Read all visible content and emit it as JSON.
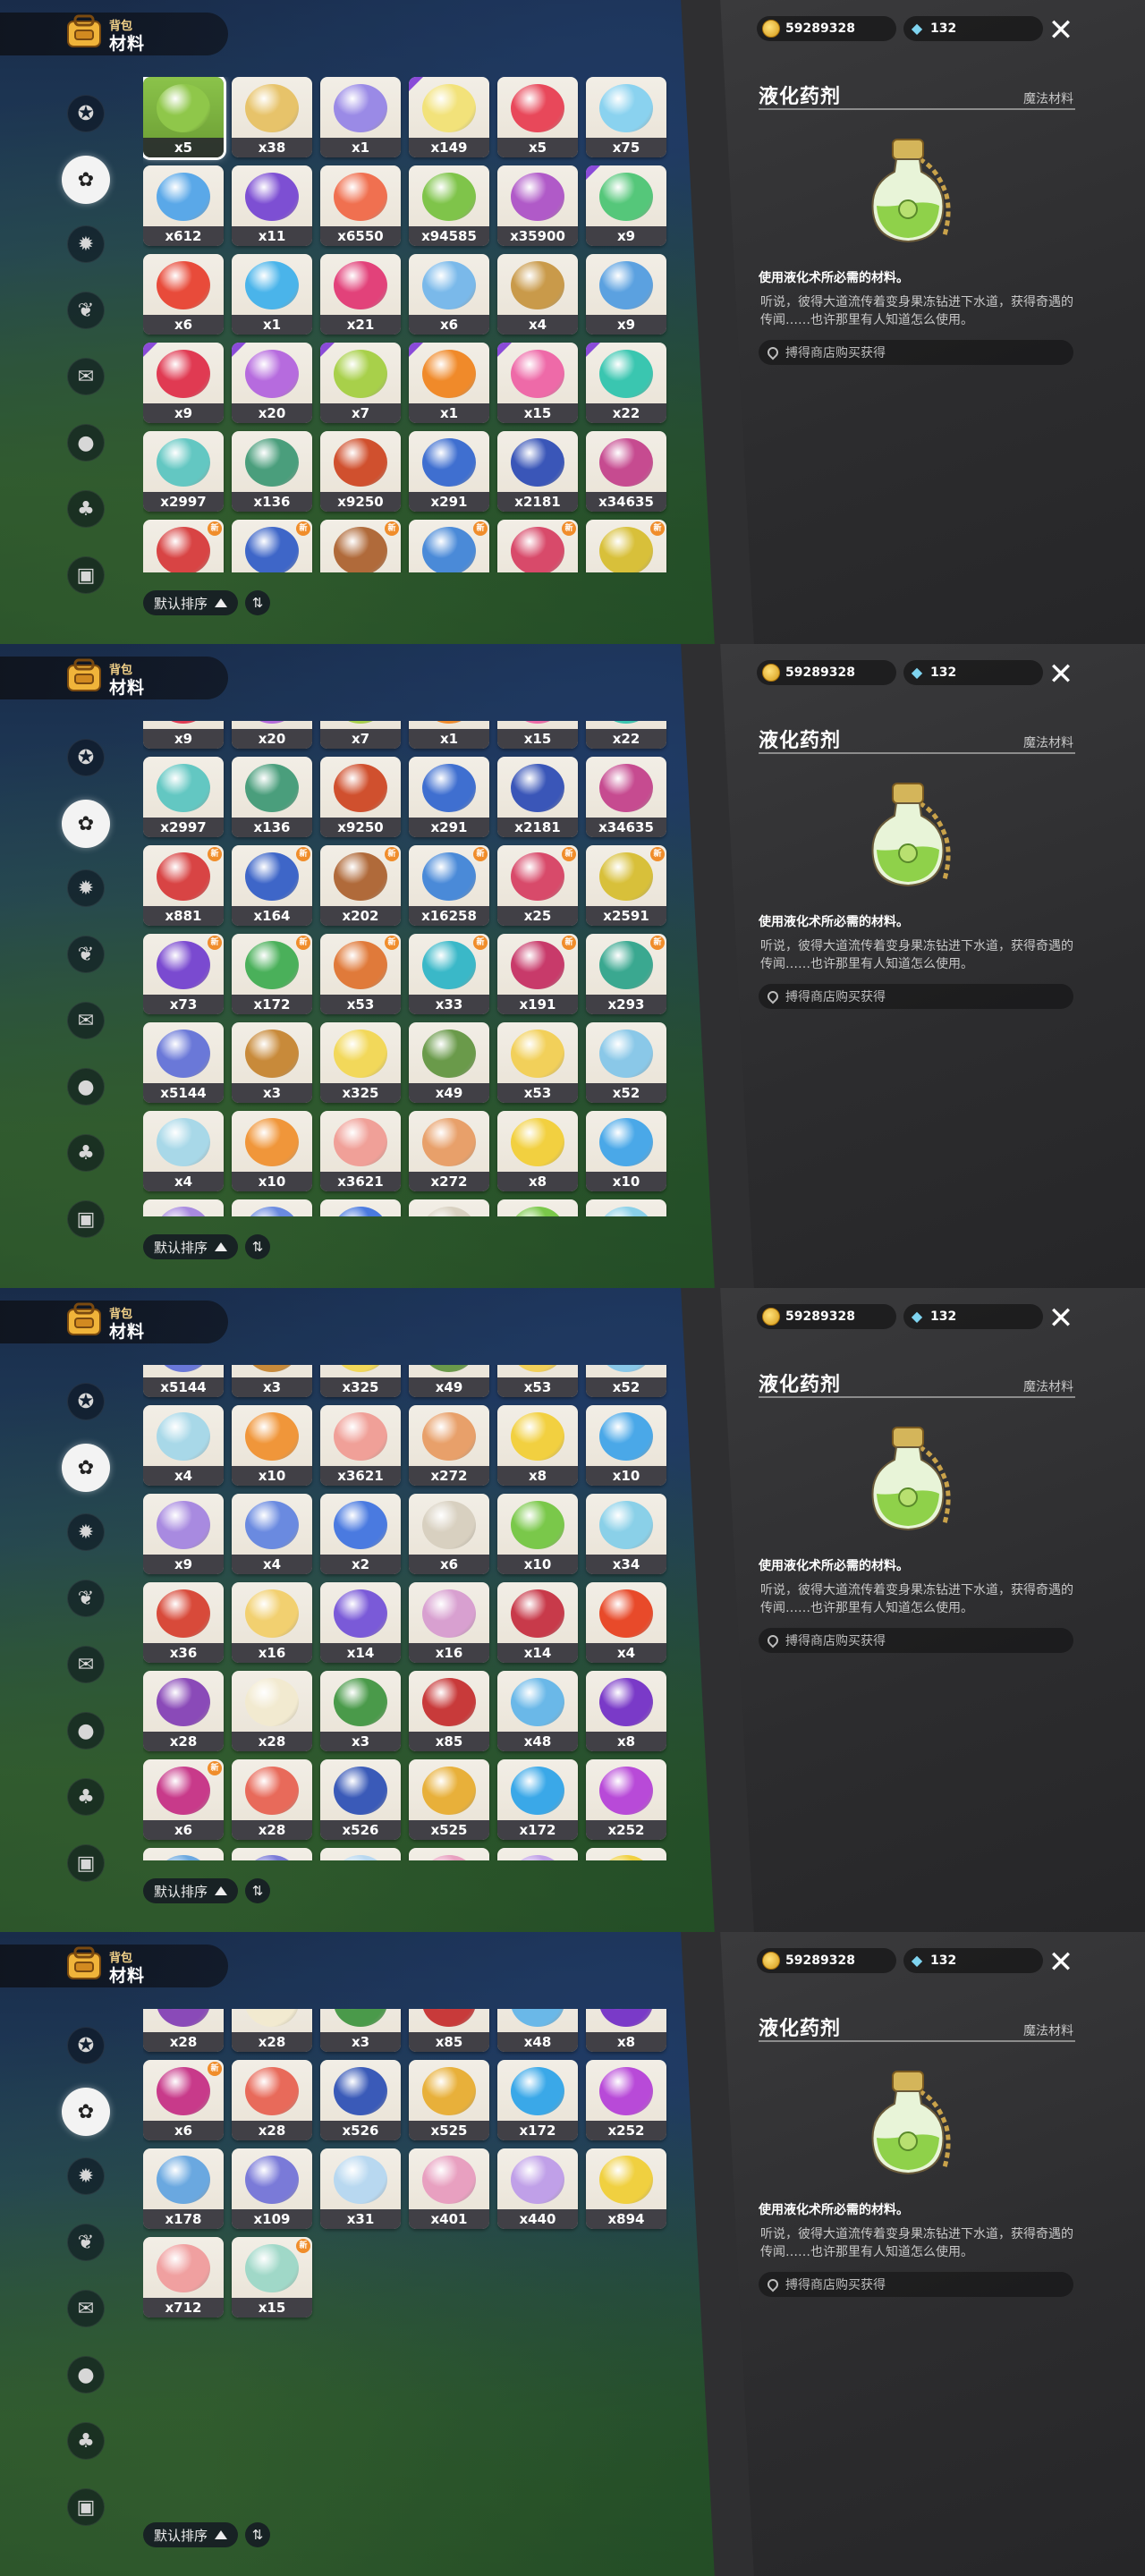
{
  "header": {
    "subtitle": "背包",
    "title": "材料"
  },
  "currency": {
    "coins": "59289328",
    "gems": "132"
  },
  "close_label": "✕",
  "sidebar": {
    "items": [
      {
        "icon": "star-badge-icon",
        "glyph": "✪"
      },
      {
        "icon": "leaf-cluster-icon",
        "glyph": "✿"
      },
      {
        "icon": "gear-star-icon",
        "glyph": "✹"
      },
      {
        "icon": "sprout-icon",
        "glyph": "❦"
      },
      {
        "icon": "scroll-icon",
        "glyph": "✉"
      },
      {
        "icon": "ball-icon",
        "glyph": "●"
      },
      {
        "icon": "acorn-icon",
        "glyph": "♣"
      },
      {
        "icon": "chest-icon",
        "glyph": "▣"
      }
    ],
    "active_index": 1
  },
  "sort": {
    "label": "默认排序",
    "toggle": "⇅"
  },
  "detail": {
    "name": "液化药剂",
    "category": "魔法材料",
    "description": "使用液化术所必需的材料。",
    "flavor": "听说，彼得大道流传着变身果冻钻进下水道，获得奇遇的传闻……也许那里有人知道怎么使用。",
    "source": "搏得商店购买获得"
  },
  "colors": {
    "selected": "#8bc34a",
    "rare_corner": "#8a4bd8",
    "new_badge": "#f08d2b"
  },
  "items": [
    {
      "q": "x5",
      "c": "#8fc74a",
      "sel": true,
      "r": false
    },
    {
      "q": "x38",
      "c": "#e7c36a",
      "r": false
    },
    {
      "q": "x1",
      "c": "#9a8ae6",
      "r": false
    },
    {
      "q": "x149",
      "c": "#f2e27a",
      "r": true
    },
    {
      "q": "x5",
      "c": "#e8485a",
      "r": false
    },
    {
      "q": "x75",
      "c": "#8ad2ef",
      "r": false
    },
    {
      "q": "x612",
      "c": "#5aa8e8",
      "r": false
    },
    {
      "q": "x11",
      "c": "#7d4fd3",
      "r": false
    },
    {
      "q": "x6550",
      "c": "#f07050",
      "r": false
    },
    {
      "q": "x94585",
      "c": "#7fc44a",
      "r": false
    },
    {
      "q": "x35900",
      "c": "#b05ac8",
      "r": false
    },
    {
      "q": "x9",
      "c": "#55c77a",
      "r": true
    },
    {
      "q": "x6",
      "c": "#e84b3a",
      "r": false
    },
    {
      "q": "x1",
      "c": "#4ab4ea",
      "r": false
    },
    {
      "q": "x21",
      "c": "#e2427a",
      "r": false
    },
    {
      "q": "x6",
      "c": "#7ab9ea",
      "r": false
    },
    {
      "q": "x4",
      "c": "#c99a4a",
      "r": false
    },
    {
      "q": "x9",
      "c": "#5ba1e0",
      "r": false
    },
    {
      "q": "x9",
      "c": "#e03a52",
      "r": true
    },
    {
      "q": "x20",
      "c": "#b66bde",
      "r": true
    },
    {
      "q": "x7",
      "c": "#a8d04a",
      "r": true
    },
    {
      "q": "x1",
      "c": "#f08a2a",
      "r": true
    },
    {
      "q": "x15",
      "c": "#ee6aa8",
      "r": true
    },
    {
      "q": "x22",
      "c": "#3ac6b0",
      "r": true
    },
    {
      "q": "x2997",
      "c": "#63c7c2",
      "r": false
    },
    {
      "q": "x136",
      "c": "#4a9e7c",
      "r": false
    },
    {
      "q": "x9250",
      "c": "#d0502e",
      "r": false
    },
    {
      "q": "x291",
      "c": "#3f6fd0",
      "r": false
    },
    {
      "q": "x2181",
      "c": "#3a56b8",
      "r": false
    },
    {
      "q": "x34635",
      "c": "#c64b90",
      "r": false
    },
    {
      "q": "x881",
      "c": "#d84444",
      "r": false,
      "n": true
    },
    {
      "q": "x164",
      "c": "#3e66c8",
      "r": false,
      "n": true
    },
    {
      "q": "x202",
      "c": "#b06a3a",
      "r": false,
      "n": true
    },
    {
      "q": "x16258",
      "c": "#4a8ad8",
      "r": false,
      "n": true
    },
    {
      "q": "x25",
      "c": "#d84a6a",
      "r": false,
      "n": true
    },
    {
      "q": "x2591",
      "c": "#d8c03a",
      "r": false,
      "n": true
    },
    {
      "q": "x73",
      "c": "#7a4ad0",
      "r": false,
      "n": true
    },
    {
      "q": "x172",
      "c": "#4ab05a",
      "r": false,
      "n": true
    },
    {
      "q": "x53",
      "c": "#e07a3a",
      "r": false,
      "n": true
    },
    {
      "q": "x33",
      "c": "#3ab8c8",
      "r": false,
      "n": true
    },
    {
      "q": "x191",
      "c": "#c83a6a",
      "r": false,
      "n": true
    },
    {
      "q": "x293",
      "c": "#3aa890",
      "r": false,
      "n": true
    },
    {
      "q": "x5144",
      "c": "#6a78d8",
      "r": false
    },
    {
      "q": "x3",
      "c": "#c88a3a",
      "r": false
    },
    {
      "q": "x325",
      "c": "#f2d85a",
      "r": false
    },
    {
      "q": "x49",
      "c": "#6a9a4a",
      "r": false
    },
    {
      "q": "x53",
      "c": "#f2d05a",
      "r": false
    },
    {
      "q": "x52",
      "c": "#8ac8e8",
      "r": false
    },
    {
      "q": "x4",
      "c": "#a8d8e8",
      "r": false
    },
    {
      "q": "x10",
      "c": "#f0963a",
      "r": false
    },
    {
      "q": "x3621",
      "c": "#f0a098",
      "r": false
    },
    {
      "q": "x272",
      "c": "#e8a06a",
      "r": false
    },
    {
      "q": "x8",
      "c": "#f2d040",
      "r": false
    },
    {
      "q": "x10",
      "c": "#4aa8e8",
      "r": false
    },
    {
      "q": "x9",
      "c": "#a88ae0",
      "r": false
    },
    {
      "q": "x4",
      "c": "#6a8ae0",
      "r": false
    },
    {
      "q": "x2",
      "c": "#4a7ae0",
      "r": false
    },
    {
      "q": "x6",
      "c": "#d8d0c0",
      "r": false
    },
    {
      "q": "x10",
      "c": "#7ac84a",
      "r": false
    },
    {
      "q": "x34",
      "c": "#8ad0e8",
      "r": false
    },
    {
      "q": "x36",
      "c": "#d84a3a",
      "r": false
    },
    {
      "q": "x16",
      "c": "#f2d070",
      "r": false
    },
    {
      "q": "x14",
      "c": "#7a5ad8",
      "r": false
    },
    {
      "q": "x16",
      "c": "#d8a0d0",
      "r": false
    },
    {
      "q": "x14",
      "c": "#c83a4a",
      "r": false
    },
    {
      "q": "x4",
      "c": "#e84a2a",
      "r": false
    },
    {
      "q": "x28",
      "c": "#8a4ab8",
      "r": false
    },
    {
      "q": "x28",
      "c": "#f2ead0",
      "r": false
    },
    {
      "q": "x3",
      "c": "#4a9a4a",
      "r": false
    },
    {
      "q": "x85",
      "c": "#c83a3a",
      "r": false
    },
    {
      "q": "x48",
      "c": "#6ab8e8",
      "r": false
    },
    {
      "q": "x8",
      "c": "#7a3ac8",
      "r": false
    },
    {
      "q": "x6",
      "c": "#c83a8a",
      "r": false,
      "n": true
    },
    {
      "q": "x28",
      "c": "#e86a5a",
      "r": false
    },
    {
      "q": "x526",
      "c": "#3a5ab8",
      "r": false
    },
    {
      "q": "x525",
      "c": "#e8b03a",
      "r": false
    },
    {
      "q": "x172",
      "c": "#3aa8e8",
      "r": false
    },
    {
      "q": "x252",
      "c": "#b84ad8",
      "r": false
    },
    {
      "q": "x178",
      "c": "#6aa8e0",
      "r": false
    },
    {
      "q": "x109",
      "c": "#7a7ad8",
      "r": false
    },
    {
      "q": "x31",
      "c": "#b8d8f0",
      "r": false
    },
    {
      "q": "x401",
      "c": "#e8a0c0",
      "r": false
    },
    {
      "q": "x440",
      "c": "#c0a0e8",
      "r": false
    },
    {
      "q": "x894",
      "c": "#f0d040",
      "r": false
    },
    {
      "q": "x712",
      "c": "#f0a0a0",
      "r": false
    },
    {
      "q": "x15",
      "c": "#a0d8c8",
      "r": false,
      "n": true
    }
  ]
}
